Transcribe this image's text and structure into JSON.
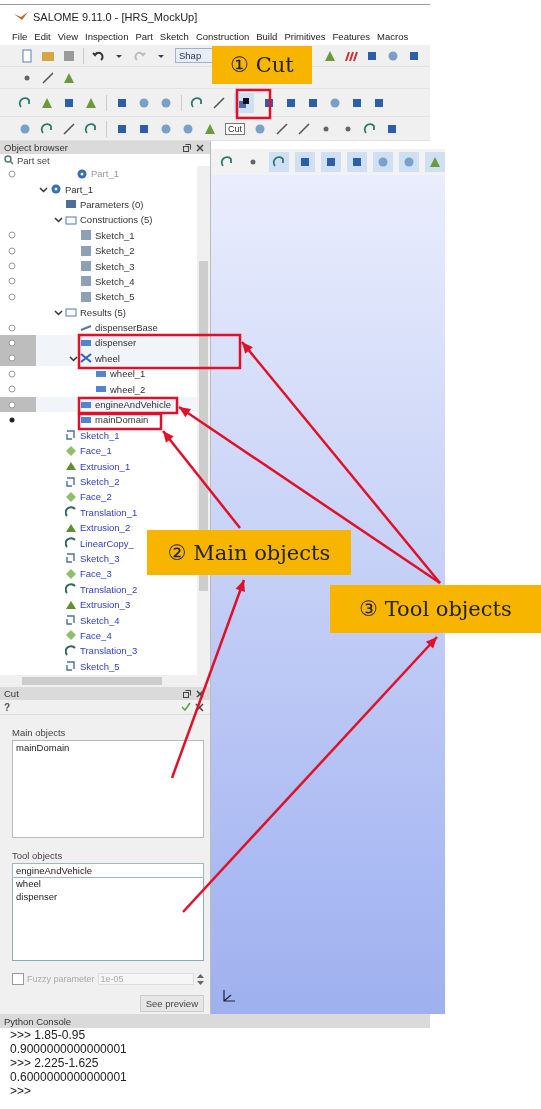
{
  "window": {
    "title": "SALOME 9.11.0 - [HRS_MockUp]"
  },
  "menu": [
    "File",
    "Edit",
    "View",
    "Inspection",
    "Part",
    "Sketch",
    "Construction",
    "Build",
    "Primitives",
    "Features",
    "Macros"
  ],
  "toolbar": {
    "combo": "Shap",
    "tooltip": "Cut"
  },
  "object_browser": {
    "title": "Object browser",
    "root": "Part set",
    "tree": [
      {
        "label": "Part_1",
        "kind": "part",
        "selected": false,
        "disabled": true,
        "visible": false
      },
      {
        "label": "Part_1",
        "kind": "part",
        "selected": false,
        "disabled": false,
        "expanded": true,
        "children": [
          {
            "label": "Parameters (0)",
            "kind": "parameters",
            "selected": false,
            "disabled": false
          },
          {
            "label": "Constructions (5)",
            "kind": "folder",
            "selected": false,
            "disabled": false,
            "expanded": true,
            "children": [
              {
                "label": "Sketch_1",
                "kind": "sketch",
                "selected": false,
                "disabled": false,
                "visible": false
              },
              {
                "label": "Sketch_2",
                "kind": "sketch",
                "selected": false,
                "disabled": false,
                "visible": false
              },
              {
                "label": "Sketch_3",
                "kind": "sketch",
                "selected": false,
                "disabled": false,
                "visible": false
              },
              {
                "label": "Sketch_4",
                "kind": "sketch",
                "selected": false,
                "disabled": false,
                "visible": false
              },
              {
                "label": "Sketch_5",
                "kind": "sketch",
                "selected": false,
                "disabled": false,
                "visible": false
              }
            ]
          },
          {
            "label": "Results (5)",
            "kind": "folder",
            "selected": false,
            "disabled": false,
            "expanded": true,
            "children": [
              {
                "label": "dispenserBase",
                "kind": "shell",
                "selected": false,
                "disabled": false,
                "visible": false
              },
              {
                "label": "dispenser",
                "kind": "solid",
                "selected": true,
                "disabled": false,
                "visible": false
              },
              {
                "label": "wheel",
                "kind": "compound",
                "selected": true,
                "disabled": false,
                "visible": false,
                "expanded": true,
                "children": [
                  {
                    "label": "wheel_1",
                    "kind": "solid",
                    "selected": false,
                    "disabled": false,
                    "visible": false
                  },
                  {
                    "label": "wheel_2",
                    "kind": "solid",
                    "selected": false,
                    "disabled": false,
                    "visible": false
                  }
                ]
              },
              {
                "label": "engineAndVehicle",
                "kind": "solid",
                "selected": true,
                "disabled": false,
                "visible": false
              },
              {
                "label": "mainDomain",
                "kind": "solid",
                "selected": false,
                "disabled": false,
                "visible": true
              }
            ]
          },
          {
            "label": "Sketch_1",
            "kind": "sketch-feature",
            "selected": false,
            "disabled": false
          },
          {
            "label": "Face_1",
            "kind": "face",
            "selected": false,
            "disabled": false
          },
          {
            "label": "Extrusion_1",
            "kind": "extrusion",
            "selected": false,
            "disabled": false
          },
          {
            "label": "Sketch_2",
            "kind": "sketch-feature",
            "selected": false,
            "disabled": false
          },
          {
            "label": "Face_2",
            "kind": "face",
            "selected": false,
            "disabled": false
          },
          {
            "label": "Translation_1",
            "kind": "translation",
            "selected": false,
            "disabled": false
          },
          {
            "label": "Extrusion_2",
            "kind": "extrusion",
            "selected": false,
            "disabled": false
          },
          {
            "label": "LinearCopy_",
            "kind": "translation",
            "selected": false,
            "disabled": false
          },
          {
            "label": "Sketch_3",
            "kind": "sketch-feature",
            "selected": false,
            "disabled": false
          },
          {
            "label": "Face_3",
            "kind": "face",
            "selected": false,
            "disabled": false
          },
          {
            "label": "Translation_2",
            "kind": "translation",
            "selected": false,
            "disabled": false
          },
          {
            "label": "Extrusion_3",
            "kind": "extrusion",
            "selected": false,
            "disabled": false
          },
          {
            "label": "Sketch_4",
            "kind": "sketch-feature",
            "selected": false,
            "disabled": false
          },
          {
            "label": "Face_4",
            "kind": "face",
            "selected": false,
            "disabled": false
          },
          {
            "label": "Translation_3",
            "kind": "translation",
            "selected": false,
            "disabled": false
          },
          {
            "label": "Sketch_5",
            "kind": "sketch-feature",
            "selected": false,
            "disabled": false
          }
        ]
      }
    ]
  },
  "cut_panel": {
    "title": "Cut",
    "help": "?",
    "main_objects_label": "Main objects",
    "main_objects": [
      {
        "name": "mainDomain",
        "selected": false
      }
    ],
    "tool_objects_label": "Tool objects",
    "tool_objects": [
      {
        "name": "engineAndVehicle",
        "selected": true
      },
      {
        "name": "wheel",
        "selected": false
      },
      {
        "name": "dispenser",
        "selected": false
      }
    ],
    "fuzzy": {
      "label": "Fuzzy parameter",
      "checked": false,
      "value": "1e-05"
    },
    "preview_button": "See preview"
  },
  "console": {
    "title": "Python Console",
    "lines": [
      ">>> 1.85-0.95",
      "0.9000000000000001",
      ">>> 2.225-1.625",
      "0.6000000000000001",
      ">>>"
    ]
  },
  "annotations": [
    {
      "label": "① Cut"
    },
    {
      "label": "② Main objects"
    },
    {
      "label": "③ Tool objects"
    }
  ]
}
